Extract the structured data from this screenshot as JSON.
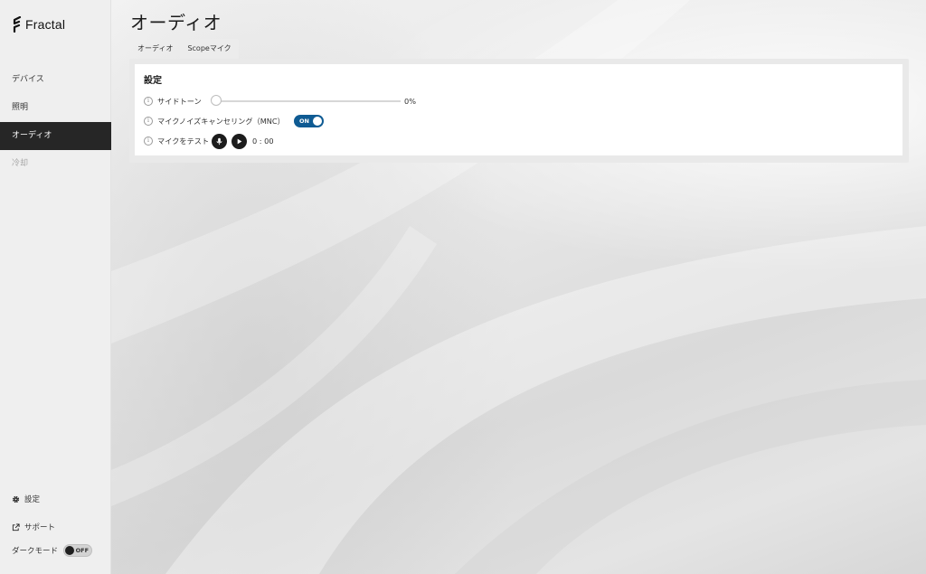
{
  "app": {
    "brand": "Fractal"
  },
  "sidebar": {
    "items": [
      {
        "label": "デバイス"
      },
      {
        "label": "照明"
      },
      {
        "label": "オーディオ"
      },
      {
        "label": "冷却"
      }
    ],
    "settings_label": "設定",
    "support_label": "サポート",
    "dark_mode_label": "ダークモード",
    "dark_mode_state": "OFF"
  },
  "main": {
    "title": "オーディオ",
    "tabs": [
      {
        "label": "オーディオ"
      },
      {
        "label": "Scopeマイク"
      }
    ],
    "panel": {
      "title": "設定",
      "sidetone": {
        "label": "サイドトーン",
        "value": "0%",
        "level": 0
      },
      "mnc": {
        "label": "マイクノイズキャンセリング（MNC）",
        "state": "ON"
      },
      "mic_test": {
        "label": "マイクをテスト",
        "time": "0 : 00"
      }
    }
  },
  "colors": {
    "accent": "#0f5b93",
    "active_nav": "#262626"
  }
}
